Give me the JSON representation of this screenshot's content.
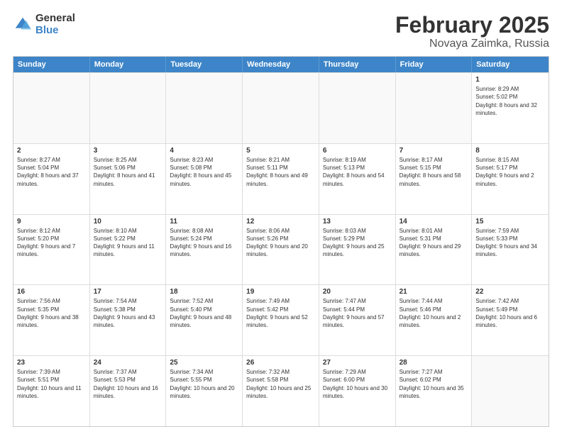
{
  "logo": {
    "general": "General",
    "blue": "Blue"
  },
  "title": {
    "month": "February 2025",
    "location": "Novaya Zaimka, Russia"
  },
  "header_days": [
    "Sunday",
    "Monday",
    "Tuesday",
    "Wednesday",
    "Thursday",
    "Friday",
    "Saturday"
  ],
  "weeks": [
    [
      {
        "day": "",
        "info": ""
      },
      {
        "day": "",
        "info": ""
      },
      {
        "day": "",
        "info": ""
      },
      {
        "day": "",
        "info": ""
      },
      {
        "day": "",
        "info": ""
      },
      {
        "day": "",
        "info": ""
      },
      {
        "day": "1",
        "info": "Sunrise: 8:29 AM\nSunset: 5:02 PM\nDaylight: 8 hours and 32 minutes."
      }
    ],
    [
      {
        "day": "2",
        "info": "Sunrise: 8:27 AM\nSunset: 5:04 PM\nDaylight: 8 hours and 37 minutes."
      },
      {
        "day": "3",
        "info": "Sunrise: 8:25 AM\nSunset: 5:06 PM\nDaylight: 8 hours and 41 minutes."
      },
      {
        "day": "4",
        "info": "Sunrise: 8:23 AM\nSunset: 5:08 PM\nDaylight: 8 hours and 45 minutes."
      },
      {
        "day": "5",
        "info": "Sunrise: 8:21 AM\nSunset: 5:11 PM\nDaylight: 8 hours and 49 minutes."
      },
      {
        "day": "6",
        "info": "Sunrise: 8:19 AM\nSunset: 5:13 PM\nDaylight: 8 hours and 54 minutes."
      },
      {
        "day": "7",
        "info": "Sunrise: 8:17 AM\nSunset: 5:15 PM\nDaylight: 8 hours and 58 minutes."
      },
      {
        "day": "8",
        "info": "Sunrise: 8:15 AM\nSunset: 5:17 PM\nDaylight: 9 hours and 2 minutes."
      }
    ],
    [
      {
        "day": "9",
        "info": "Sunrise: 8:12 AM\nSunset: 5:20 PM\nDaylight: 9 hours and 7 minutes."
      },
      {
        "day": "10",
        "info": "Sunrise: 8:10 AM\nSunset: 5:22 PM\nDaylight: 9 hours and 11 minutes."
      },
      {
        "day": "11",
        "info": "Sunrise: 8:08 AM\nSunset: 5:24 PM\nDaylight: 9 hours and 16 minutes."
      },
      {
        "day": "12",
        "info": "Sunrise: 8:06 AM\nSunset: 5:26 PM\nDaylight: 9 hours and 20 minutes."
      },
      {
        "day": "13",
        "info": "Sunrise: 8:03 AM\nSunset: 5:29 PM\nDaylight: 9 hours and 25 minutes."
      },
      {
        "day": "14",
        "info": "Sunrise: 8:01 AM\nSunset: 5:31 PM\nDaylight: 9 hours and 29 minutes."
      },
      {
        "day": "15",
        "info": "Sunrise: 7:59 AM\nSunset: 5:33 PM\nDaylight: 9 hours and 34 minutes."
      }
    ],
    [
      {
        "day": "16",
        "info": "Sunrise: 7:56 AM\nSunset: 5:35 PM\nDaylight: 9 hours and 38 minutes."
      },
      {
        "day": "17",
        "info": "Sunrise: 7:54 AM\nSunset: 5:38 PM\nDaylight: 9 hours and 43 minutes."
      },
      {
        "day": "18",
        "info": "Sunrise: 7:52 AM\nSunset: 5:40 PM\nDaylight: 9 hours and 48 minutes."
      },
      {
        "day": "19",
        "info": "Sunrise: 7:49 AM\nSunset: 5:42 PM\nDaylight: 9 hours and 52 minutes."
      },
      {
        "day": "20",
        "info": "Sunrise: 7:47 AM\nSunset: 5:44 PM\nDaylight: 9 hours and 57 minutes."
      },
      {
        "day": "21",
        "info": "Sunrise: 7:44 AM\nSunset: 5:46 PM\nDaylight: 10 hours and 2 minutes."
      },
      {
        "day": "22",
        "info": "Sunrise: 7:42 AM\nSunset: 5:49 PM\nDaylight: 10 hours and 6 minutes."
      }
    ],
    [
      {
        "day": "23",
        "info": "Sunrise: 7:39 AM\nSunset: 5:51 PM\nDaylight: 10 hours and 11 minutes."
      },
      {
        "day": "24",
        "info": "Sunrise: 7:37 AM\nSunset: 5:53 PM\nDaylight: 10 hours and 16 minutes."
      },
      {
        "day": "25",
        "info": "Sunrise: 7:34 AM\nSunset: 5:55 PM\nDaylight: 10 hours and 20 minutes."
      },
      {
        "day": "26",
        "info": "Sunrise: 7:32 AM\nSunset: 5:58 PM\nDaylight: 10 hours and 25 minutes."
      },
      {
        "day": "27",
        "info": "Sunrise: 7:29 AM\nSunset: 6:00 PM\nDaylight: 10 hours and 30 minutes."
      },
      {
        "day": "28",
        "info": "Sunrise: 7:27 AM\nSunset: 6:02 PM\nDaylight: 10 hours and 35 minutes."
      },
      {
        "day": "",
        "info": ""
      }
    ]
  ]
}
